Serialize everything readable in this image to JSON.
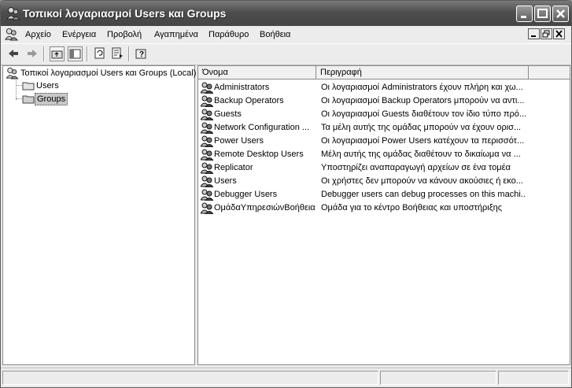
{
  "window": {
    "title": "Τοπικοί λογαριασμοί Users και Groups"
  },
  "menu": {
    "items": [
      "Αρχείο",
      "Ενέργεια",
      "Προβολή",
      "Αγαπημένα",
      "Παράθυρο",
      "Βοήθεια"
    ]
  },
  "tree": {
    "root": "Τοπικοί λογαριασμοί Users και Groups (Local)",
    "children": [
      "Users",
      "Groups"
    ],
    "selected": "Groups"
  },
  "list": {
    "columns": [
      "Όνομα",
      "Περιγραφή"
    ],
    "rows": [
      {
        "name": "Administrators",
        "desc": "Οι λογαριασμοί Administrators έχουν πλήρη και χω..."
      },
      {
        "name": "Backup Operators",
        "desc": "Οι λογαριασμοί Backup Operators μπορούν να αντι..."
      },
      {
        "name": "Guests",
        "desc": "Οι λογαριασμοί Guests διαθέτουν τον ίδιο τύπο πρό..."
      },
      {
        "name": "Network Configuration ...",
        "desc": "Τα μέλη αυτής της ομάδας μπορούν να έχουν ορισ..."
      },
      {
        "name": "Power Users",
        "desc": "Οι λογαριασμοί Power Users κατέχουν τα περισσότ..."
      },
      {
        "name": "Remote Desktop Users",
        "desc": "Μέλη αυτής της ομάδας διαθέτουν το δικαίωμα να ..."
      },
      {
        "name": "Replicator",
        "desc": "Υποστηρίζει αναπαραγωγή αρχείων σε ένα τομέα"
      },
      {
        "name": "Users",
        "desc": "Οι χρήστες δεν μπορούν να κάνουν ακούσιες ή εκο..."
      },
      {
        "name": "Debugger Users",
        "desc": "Debugger users can debug processes on this machi..."
      },
      {
        "name": "ΟμάδαΥπηρεσιώνΒοήθειας",
        "desc": "Ομάδα για το κέντρο Βοήθειας και υποστήριξης"
      }
    ]
  },
  "icons": {
    "app": "users-groups-icon",
    "group": "group-icon",
    "folder": "folder-icon"
  }
}
